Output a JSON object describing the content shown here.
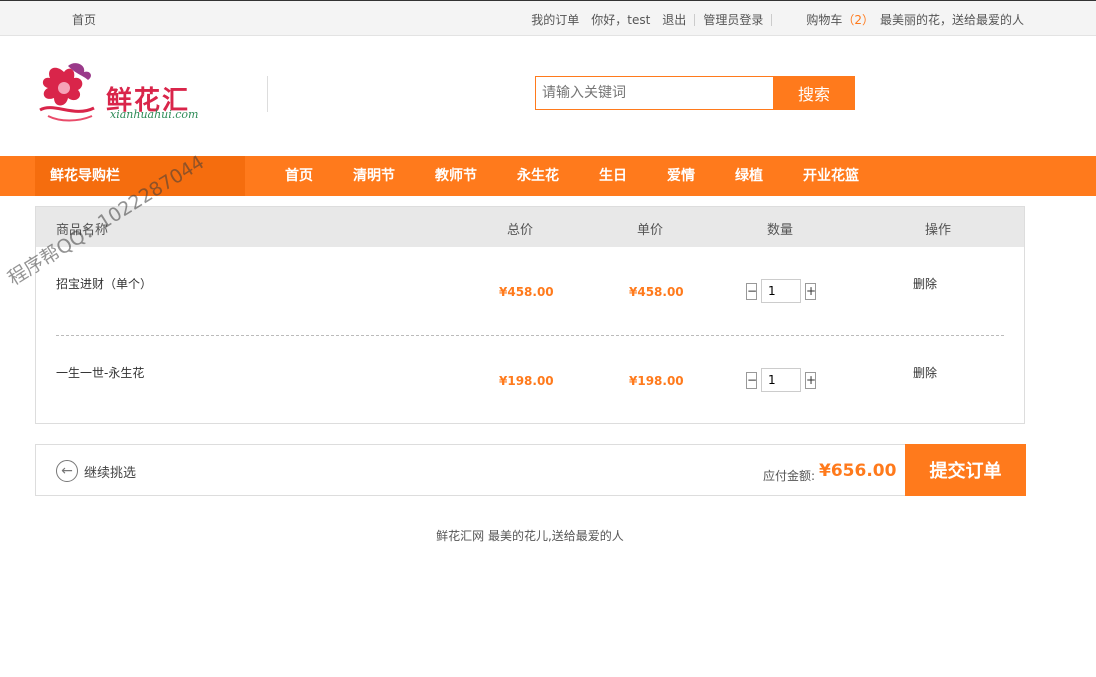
{
  "topbar": {
    "home": "首页",
    "my_orders": "我的订单",
    "greeting": "你好，test",
    "logout": "退出",
    "admin_login": "管理员登录",
    "cart_label": "购物车",
    "cart_count": "（2）",
    "slogan": "最美丽的花，送给最爱的人"
  },
  "logo": {
    "text": "鲜花汇",
    "domain": "xianhuahui.com"
  },
  "search": {
    "placeholder": "请输入关键词",
    "button": "搜索"
  },
  "nav": {
    "category": "鲜花导购栏",
    "items": [
      "首页",
      "清明节",
      "教师节",
      "永生花",
      "生日",
      "爱情",
      "绿植",
      "开业花篮"
    ]
  },
  "cart": {
    "headers": {
      "name": "商品名称",
      "total": "总价",
      "unit": "单价",
      "qty": "数量",
      "action": "操作"
    },
    "rows": [
      {
        "name": "招宝进财（单个）",
        "total": "¥458.00",
        "unit": "¥458.00",
        "qty": "1",
        "delete": "删除"
      },
      {
        "name": "一生一世-永生花",
        "total": "¥198.00",
        "unit": "¥198.00",
        "qty": "1",
        "delete": "删除"
      }
    ],
    "minus": "−",
    "plus": "+"
  },
  "checkout": {
    "back": "继续挑选",
    "total_label": "应付金额:",
    "total_value": "¥656.00",
    "submit": "提交订单"
  },
  "footer": "鲜花汇网 最美的花儿,送给最爱的人",
  "watermark": "程序帮QQ：1022287044",
  "colors": {
    "accent": "#ff7a1c",
    "accent_dark": "#f56d0e"
  }
}
